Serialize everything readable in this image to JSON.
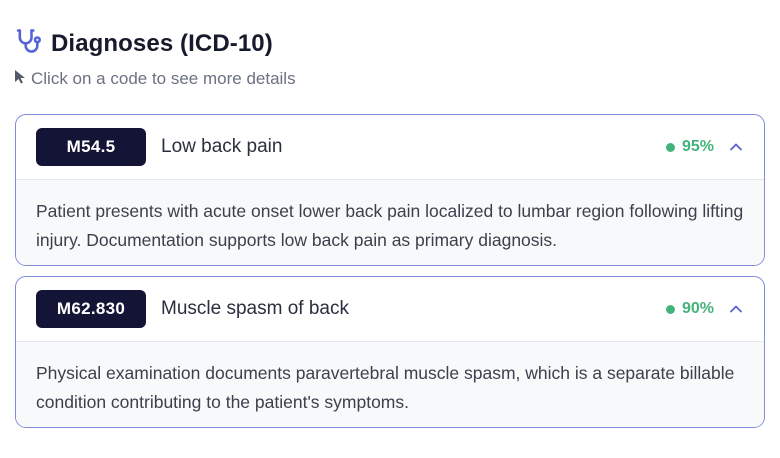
{
  "header": {
    "title": "Diagnoses (ICD-10)",
    "icon": "stethoscope-icon",
    "accent": "#5564d6"
  },
  "hint": {
    "icon": "cursor-pointer-icon",
    "text": "Click on a code to see more details"
  },
  "diagnoses": [
    {
      "code": "M54.5",
      "description": "Low back pain",
      "confidence": "95%",
      "expanded": true,
      "details": "Patient presents with acute onset lower back pain localized to lumbar region following lifting injury. Documentation supports low back pain as primary diagnosis."
    },
    {
      "code": "M62.830",
      "description": "Muscle spasm of back",
      "confidence": "90%",
      "expanded": true,
      "details": "Physical examination documents paravertebral muscle spasm, which is a separate billable condition contributing to the patient's symptoms."
    }
  ],
  "colors": {
    "badge_bg": "#141536",
    "confidence": "#44b37b",
    "card_border": "#7f8cd9"
  }
}
